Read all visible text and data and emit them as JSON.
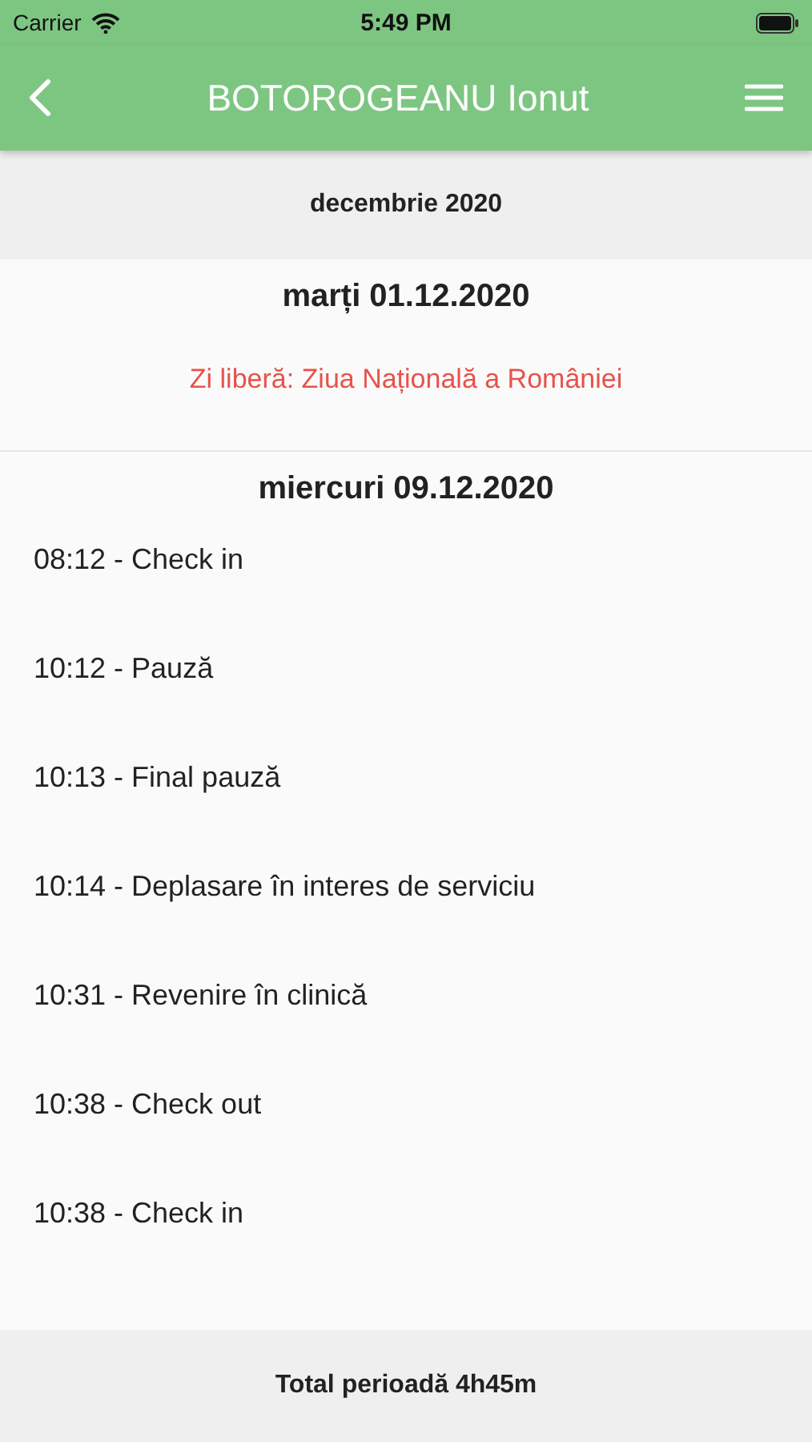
{
  "status_bar": {
    "carrier": "Carrier",
    "time": "5:49 PM"
  },
  "nav_bar": {
    "title": "BOTOROGEANU Ionut"
  },
  "month": "decembrie 2020",
  "days": [
    {
      "date": "marți 01.12.2020",
      "kind": "holiday",
      "note": "Zi liberă: Ziua Națională a României"
    },
    {
      "date": "miercuri 09.12.2020",
      "kind": "entries",
      "entries": [
        "08:12 - Check in",
        "10:12 - Pauză",
        "10:13 - Final pauză",
        "10:14 - Deplasare în interes de serviciu",
        "10:31 - Revenire în clinică",
        "10:38 - Check out",
        "10:38 - Check in"
      ]
    }
  ],
  "footer": "Total perioadă 4h45m"
}
